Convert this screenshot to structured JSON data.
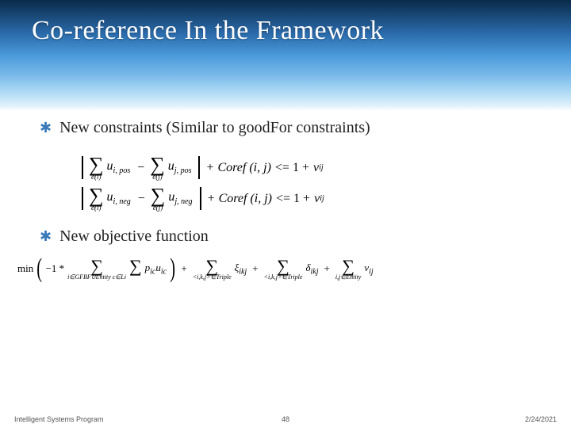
{
  "header": {
    "title": "Co-reference In the Framework"
  },
  "bullets": {
    "b1": "New constraints (Similar to goodFor constraints)",
    "b2": "New objective function"
  },
  "constraints": {
    "eq1": {
      "s1_sub": "e(i)",
      "t1": "u",
      "t1_sub": "i, pos",
      "s2_sub": "e(j)",
      "t2": "u",
      "t2_sub": "j, pos",
      "coref": "Coref (i, j)",
      "op_le": "<= 1 +",
      "nu": "ν",
      "nu_sub": "ij"
    },
    "eq2": {
      "s1_sub": "e(i)",
      "t1": "u",
      "t1_sub": "i, neg",
      "s2_sub": "e(j)",
      "t2": "u",
      "t2_sub": "j, neg",
      "coref": "Coref (i, j)",
      "op_le": "<= 1 +",
      "nu": "ν",
      "nu_sub": "ij"
    }
  },
  "objective": {
    "min": "min",
    "neg1": "−1 *",
    "s1_sub": "i∈GFBF∪Entity c∈Li",
    "t1": "p",
    "t1_sub": "ic",
    "t1b": "u",
    "t1b_sub": "ic",
    "plus": "+",
    "s2_sub": "<i,k,j>∈Triple",
    "xi": "ξ",
    "xi_sub": "ikj",
    "s3_sub": "<i,k,j>∈Triple",
    "delta": "δ",
    "delta_sub": "ikj",
    "s4_sub": "i,j∈Entity",
    "nu": "ν",
    "nu_sub": "ij"
  },
  "footer": {
    "left": "Intelligent Systems Program",
    "center": "48",
    "right": "2/24/2021"
  }
}
